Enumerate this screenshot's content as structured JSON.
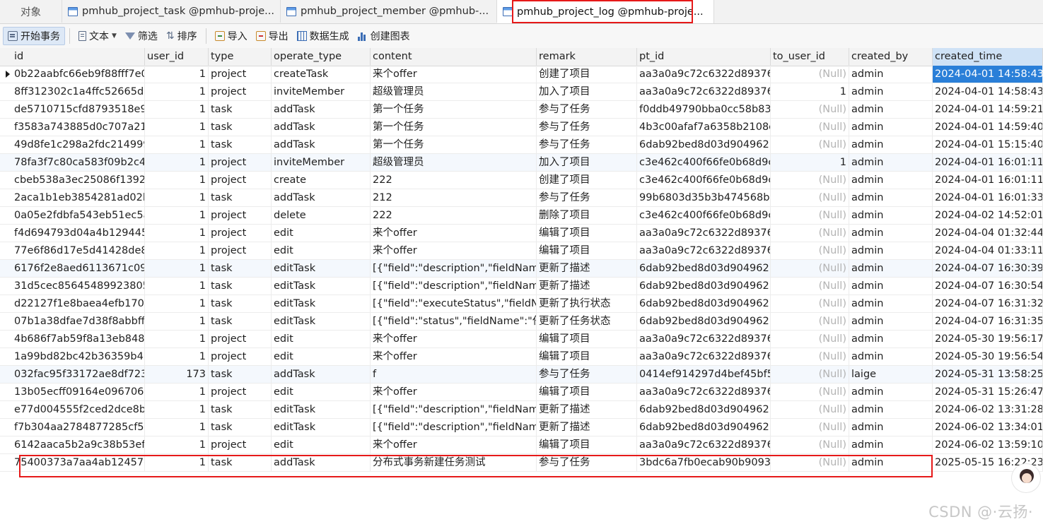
{
  "tabs": [
    {
      "label": "对象"
    },
    {
      "label": "pmhub_project_task @pmhub-proje..."
    },
    {
      "label": "pmhub_project_member @pmhub-..."
    },
    {
      "label": "pmhub_project_log @pmhub-proje..."
    }
  ],
  "toolbar": {
    "begin_transaction": "开始事务",
    "text": "文本",
    "filter": "筛选",
    "sort": "排序",
    "import": "导入",
    "export": "导出",
    "data_generation": "数据生成",
    "create_chart": "创建图表"
  },
  "table": {
    "columns": [
      "id",
      "user_id",
      "type",
      "operate_type",
      "content",
      "remark",
      "pt_id",
      "to_user_id",
      "created_by",
      "created_time"
    ],
    "null_text": "(Null)",
    "rows": [
      [
        "0b22aabfc66eb9f88fff7e0",
        "1",
        "project",
        "createTask",
        "来个offer",
        "创建了项目",
        "aa3a0a9c72c6322d89376",
        "(Null)",
        "admin",
        "2024-04-01 14:58:43"
      ],
      [
        "8ff312302c1a4ffc52665d8",
        "1",
        "project",
        "inviteMember",
        "超级管理员",
        "加入了项目",
        "aa3a0a9c72c6322d89376",
        "1",
        "admin",
        "2024-04-01 14:58:43"
      ],
      [
        "de5710715cfd8793518e9",
        "1",
        "task",
        "addTask",
        "第一个任务",
        "参与了任务",
        "f0ddb49790bba0cc58b83",
        "(Null)",
        "admin",
        "2024-04-01 14:59:21"
      ],
      [
        "f3583a743885d0c707a21",
        "1",
        "task",
        "addTask",
        "第一个任务",
        "参与了任务",
        "4b3c00afaf7a6358b2108c",
        "(Null)",
        "admin",
        "2024-04-01 14:59:40"
      ],
      [
        "49d8fe1c298a2fdc214999",
        "1",
        "task",
        "addTask",
        "第一个任务",
        "参与了任务",
        "6dab92bed8d03d904962",
        "(Null)",
        "admin",
        "2024-04-01 15:15:40"
      ],
      [
        "78fa3f7c80ca583f09b2c4",
        "1",
        "project",
        "inviteMember",
        "超级管理员",
        "加入了项目",
        "c3e462c400f66fe0b68d9c",
        "1",
        "admin",
        "2024-04-01 16:01:11"
      ],
      [
        "cbeb538a3ec25086f1392",
        "1",
        "project",
        "create",
        "222",
        "创建了项目",
        "c3e462c400f66fe0b68d9c",
        "(Null)",
        "admin",
        "2024-04-01 16:01:11"
      ],
      [
        "2aca1b1eb3854281ad02b",
        "1",
        "task",
        "addTask",
        "212",
        "参与了任务",
        "99b6803d35b3b474568b",
        "(Null)",
        "admin",
        "2024-04-01 16:01:33"
      ],
      [
        "0a05e2fdbfa543eb51ec5a",
        "1",
        "project",
        "delete",
        "222",
        "删除了项目",
        "c3e462c400f66fe0b68d9c",
        "(Null)",
        "admin",
        "2024-04-02 14:52:01"
      ],
      [
        "f4d694793d04a4b129445",
        "1",
        "project",
        "edit",
        "来个offer",
        "编辑了项目",
        "aa3a0a9c72c6322d89376",
        "(Null)",
        "admin",
        "2024-04-04 01:32:44"
      ],
      [
        "77e6f86d17e5d41428de8",
        "1",
        "project",
        "edit",
        "来个offer",
        "编辑了项目",
        "aa3a0a9c72c6322d89376",
        "(Null)",
        "admin",
        "2024-04-04 01:33:11"
      ],
      [
        "6176f2e8aed6113671c09",
        "1",
        "task",
        "editTask",
        "[{\"field\":\"description\",\"fieldNam",
        "更新了描述",
        "6dab92bed8d03d904962",
        "(Null)",
        "admin",
        "2024-04-07 16:30:39"
      ],
      [
        "31d5cec85645489923805",
        "1",
        "task",
        "editTask",
        "[{\"field\":\"description\",\"fieldNam",
        "更新了描述",
        "6dab92bed8d03d904962",
        "(Null)",
        "admin",
        "2024-04-07 16:30:54"
      ],
      [
        "d22127f1e8baea4efb170",
        "1",
        "task",
        "editTask",
        "[{\"field\":\"executeStatus\",\"fieldN",
        "更新了执行状态",
        "6dab92bed8d03d904962",
        "(Null)",
        "admin",
        "2024-04-07 16:31:32"
      ],
      [
        "07b1a38dfae7d38f8abbff",
        "1",
        "task",
        "editTask",
        "[{\"field\":\"status\",\"fieldName\":\"任",
        "更新了任务状态",
        "6dab92bed8d03d904962",
        "(Null)",
        "admin",
        "2024-04-07 16:31:35"
      ],
      [
        "4b686f7ab59f8a13eb848",
        "1",
        "project",
        "edit",
        "来个offer",
        "编辑了项目",
        "aa3a0a9c72c6322d89376",
        "(Null)",
        "admin",
        "2024-05-30 19:56:17"
      ],
      [
        "1a99bd82bc42b36359b4",
        "1",
        "project",
        "edit",
        "来个offer",
        "编辑了项目",
        "aa3a0a9c72c6322d89376",
        "(Null)",
        "admin",
        "2024-05-30 19:56:54"
      ],
      [
        "032fac95f33172ae8df723",
        "173",
        "task",
        "addTask",
        "f",
        "参与了任务",
        "0414ef914297d4bef45bf5",
        "(Null)",
        "laige",
        "2024-05-31 13:58:25"
      ],
      [
        "13b05ecff09164e096706",
        "1",
        "project",
        "edit",
        "来个offer",
        "编辑了项目",
        "aa3a0a9c72c6322d89376",
        "(Null)",
        "admin",
        "2024-05-31 15:26:47"
      ],
      [
        "e77d004555f2ced2dce8b",
        "1",
        "task",
        "editTask",
        "[{\"field\":\"description\",\"fieldNam",
        "更新了描述",
        "6dab92bed8d03d904962",
        "(Null)",
        "admin",
        "2024-06-02 13:31:28"
      ],
      [
        "f7b304aa2784877285cf5a",
        "1",
        "task",
        "editTask",
        "[{\"field\":\"description\",\"fieldNam",
        "更新了描述",
        "6dab92bed8d03d904962",
        "(Null)",
        "admin",
        "2024-06-02 13:34:01"
      ],
      [
        "6142aaca5b2a9c38b53ef",
        "1",
        "project",
        "edit",
        "来个offer",
        "编辑了项目",
        "aa3a0a9c72c6322d89376",
        "(Null)",
        "admin",
        "2024-06-02 13:59:10"
      ],
      [
        "75400373a7aa4ab12457e",
        "1",
        "task",
        "addTask",
        "分布式事务新建任务测试",
        "参与了任务",
        "3bdc6a7fb0ecab90b9093",
        "(Null)",
        "admin",
        "2025-05-15 16:22:23"
      ]
    ]
  },
  "watermark": "CSDN @·云扬·"
}
